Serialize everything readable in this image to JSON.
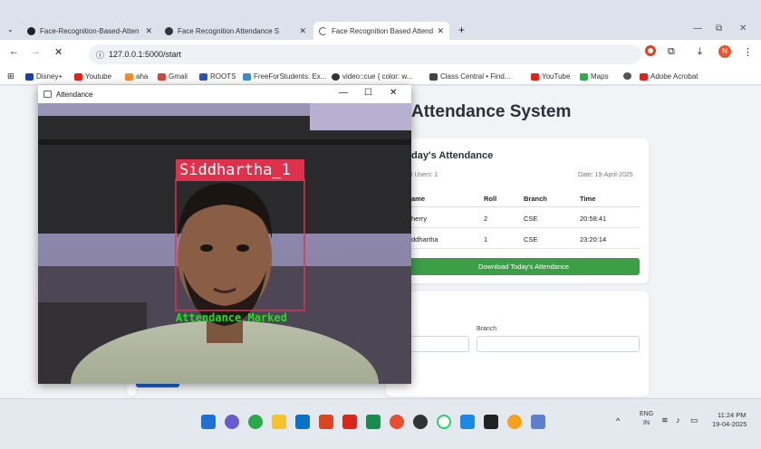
{
  "browser": {
    "tabs": [
      {
        "title": "Face-Recognition-Based-Atten",
        "icon": "github-icon",
        "active": false
      },
      {
        "title": "Face Recognition Attendance S",
        "icon": "app-icon",
        "active": false
      },
      {
        "title": "Face Recognition Based Attend",
        "icon": "loading-icon",
        "active": true
      }
    ],
    "new_tab": "+",
    "url": "127.0.0.1:5000/start",
    "bookmarks": [
      "Disney+",
      "Youtube",
      "aha",
      "Gmail",
      "ROOTS",
      "FreeForStudents: Ex...",
      "video::cue { color: w...",
      "Class Central • Find...",
      "YouTube",
      "Maps",
      "Adobe Acrobat"
    ],
    "profile_initial": "N"
  },
  "camera_window": {
    "title": "Attendance",
    "face_label": "Siddhartha_1",
    "status_text": "Attendance Marked",
    "label_color": "#e0314c",
    "status_color": "#22dd22"
  },
  "page": {
    "title": "Attendance System",
    "today": {
      "heading": "day's Attendance",
      "total_users": "l Users: 1",
      "date": "Date: 19-April-2025",
      "columns": [
        "ame",
        "Roll",
        "Branch",
        "Time"
      ],
      "rows": [
        [
          "herry",
          "2",
          "CSE",
          "20:58:41"
        ],
        [
          "ddhartha",
          "1",
          "CSE",
          "23:20:14"
        ]
      ],
      "download_label": "Download Today's Attendance"
    },
    "form": {
      "branch_label": "Branch"
    }
  },
  "taskbar": {
    "lang": "ENG",
    "region": "IN",
    "time": "11:24 PM",
    "date": "19-04-2025"
  },
  "colors": {
    "accent_green": "#3c9e47",
    "accent_blue": "#1a5fd1"
  }
}
